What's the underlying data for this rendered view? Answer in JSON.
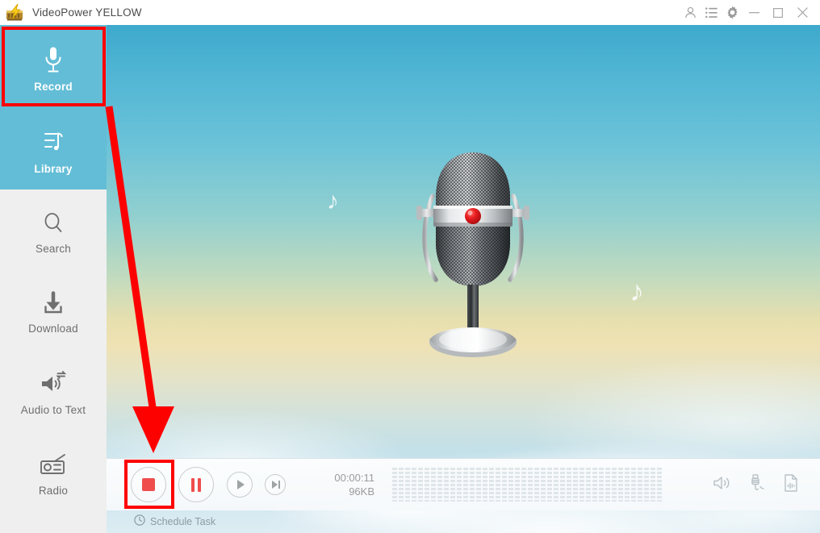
{
  "window": {
    "title": "VideoPower YELLOW",
    "logo_icon": "lightning-bolt-logo",
    "controls": [
      {
        "name": "account-icon",
        "label": "Account"
      },
      {
        "name": "list-icon",
        "label": "Task List"
      },
      {
        "name": "gear-icon",
        "label": "Settings"
      },
      {
        "name": "minimize-icon",
        "label": "Minimize"
      },
      {
        "name": "maximize-icon",
        "label": "Maximize"
      },
      {
        "name": "close-icon",
        "label": "Close"
      }
    ]
  },
  "sidebar": {
    "items": [
      {
        "label": "Record",
        "icon": "microphone-icon",
        "active": true
      },
      {
        "label": "Library",
        "icon": "music-list-icon",
        "active": true
      },
      {
        "label": "Search",
        "icon": "search-icon",
        "active": false
      },
      {
        "label": "Download",
        "icon": "download-icon",
        "active": false
      },
      {
        "label": "Audio to Text",
        "icon": "audio-to-text-icon",
        "active": false
      },
      {
        "label": "Radio",
        "icon": "radio-icon",
        "active": false
      }
    ]
  },
  "main": {
    "artwork": "retro-microphone-illustration",
    "music_note_1": "♪",
    "music_note_2": "♪"
  },
  "transport": {
    "stop_label": "Stop",
    "pause_label": "Pause",
    "play_label": "Play",
    "next_label": "Next",
    "elapsed_time": "00:00:11",
    "file_size": "96KB",
    "meter_bars": 42,
    "right_icons": [
      {
        "name": "speaker-icon",
        "label": "System Sound"
      },
      {
        "name": "microphone-jack-icon",
        "label": "Microphone"
      },
      {
        "name": "audio-file-icon",
        "label": "Output File"
      }
    ]
  },
  "statusbar": {
    "schedule_label": "Schedule Task",
    "clock_icon": "clock-icon"
  },
  "annotations": {
    "record_highlight": "red-box-around-record",
    "stop_highlight": "red-box-around-stop",
    "arrow": "red-arrow-record-to-stop"
  },
  "colors": {
    "accent_teal": "#63bdd6",
    "sidebar_bg": "#efefef",
    "annotation_red": "#fd0000",
    "record_red": "#ef4d4d",
    "text_gray": "#6e6e6e"
  }
}
